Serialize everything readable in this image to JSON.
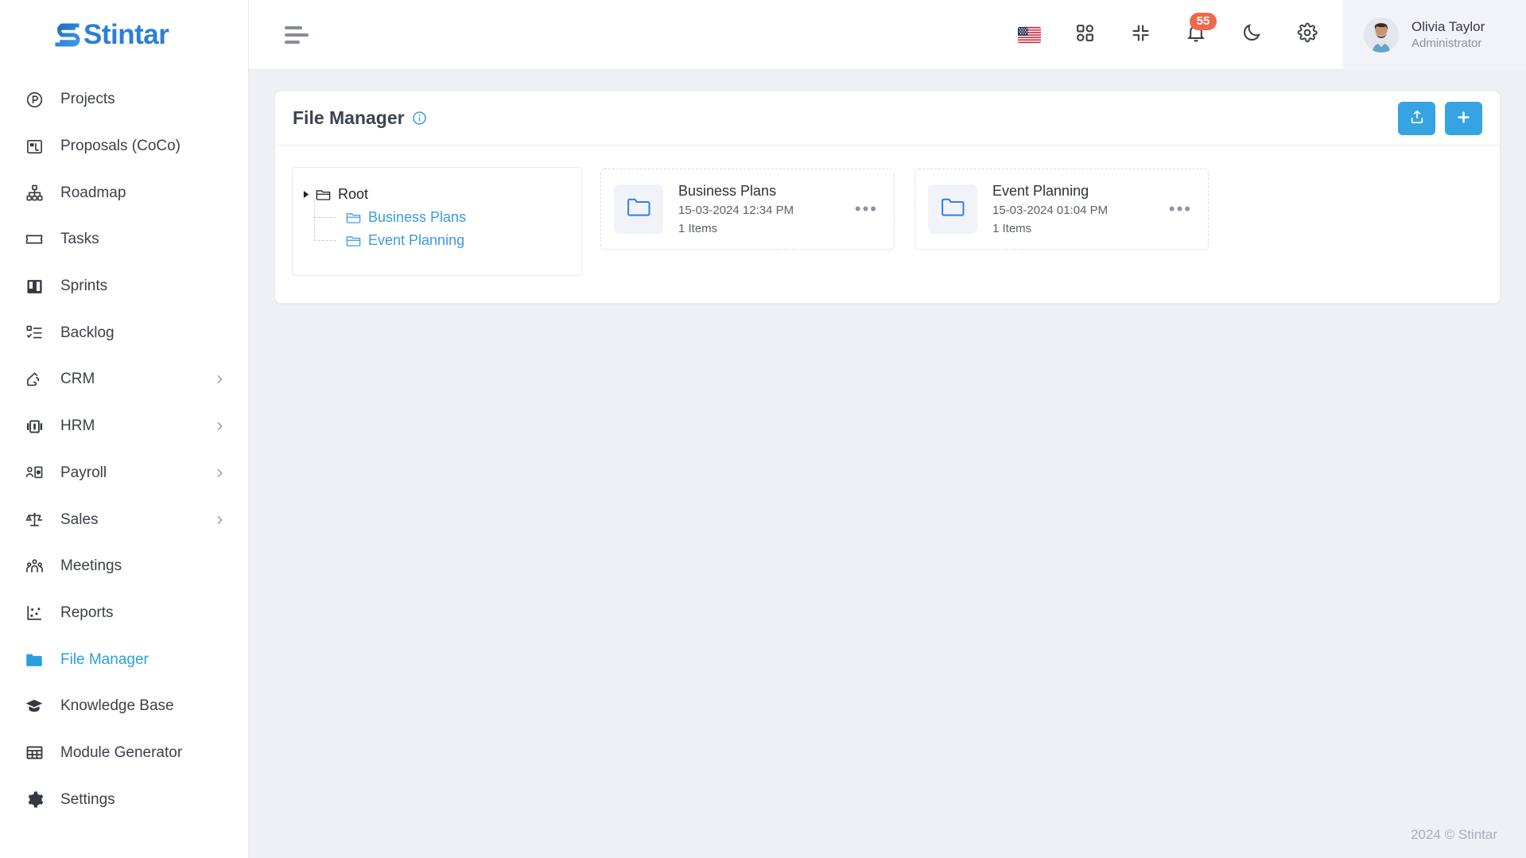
{
  "brand": {
    "name": "Stintar"
  },
  "sidebar": {
    "items": [
      {
        "label": "Projects",
        "icon": "circle-p-icon",
        "chevron": false,
        "active": false
      },
      {
        "label": "Proposals (CoCo)",
        "icon": "proposal-icon",
        "chevron": false,
        "active": false
      },
      {
        "label": "Roadmap",
        "icon": "hierarchy-icon",
        "chevron": false,
        "active": false
      },
      {
        "label": "Tasks",
        "icon": "ticket-icon",
        "chevron": false,
        "active": false
      },
      {
        "label": "Sprints",
        "icon": "board-icon",
        "chevron": false,
        "active": false
      },
      {
        "label": "Backlog",
        "icon": "checklist-icon",
        "chevron": false,
        "active": false
      },
      {
        "label": "CRM",
        "icon": "handshake-icon",
        "chevron": true,
        "active": false
      },
      {
        "label": "HRM",
        "icon": "carousel-icon",
        "chevron": true,
        "active": false
      },
      {
        "label": "Payroll",
        "icon": "person-money-icon",
        "chevron": true,
        "active": false
      },
      {
        "label": "Sales",
        "icon": "scales-icon",
        "chevron": true,
        "active": false
      },
      {
        "label": "Meetings",
        "icon": "people-group-icon",
        "chevron": false,
        "active": false
      },
      {
        "label": "Reports",
        "icon": "scatter-chart-icon",
        "chevron": false,
        "active": false
      },
      {
        "label": "File Manager",
        "icon": "folder-filled-icon",
        "chevron": false,
        "active": true
      },
      {
        "label": "Knowledge Base",
        "icon": "graduation-cap-icon",
        "chevron": false,
        "active": false
      },
      {
        "label": "Module Generator",
        "icon": "grid-table-icon",
        "chevron": false,
        "active": false
      },
      {
        "label": "Settings",
        "icon": "gear-icon",
        "chevron": false,
        "active": false
      }
    ]
  },
  "topbar": {
    "menu_toggle": "hamburger-icon",
    "language_flag": "us-flag-icon",
    "apps_icon": "apps-grid-icon",
    "fullscreen_icon": "compress-icon",
    "notifications_icon": "bell-icon",
    "notifications_count": "55",
    "theme_icon": "moon-icon",
    "settings_icon": "gear-icon",
    "user": {
      "name": "Olivia Taylor",
      "role": "Administrator"
    }
  },
  "page": {
    "title": "File Manager",
    "info_icon": "info-circle-icon",
    "upload_button": "upload-icon",
    "add_button": "plus-icon"
  },
  "tree": {
    "root": {
      "label": "Root",
      "caret": "caret-right-icon",
      "icon": "folder-open-icon"
    },
    "children": [
      {
        "label": "Business Plans",
        "icon": "folder-open-icon"
      },
      {
        "label": "Event Planning",
        "icon": "folder-open-icon"
      }
    ]
  },
  "folders": [
    {
      "name": "Business Plans",
      "date": "15-03-2024 12:34 PM",
      "items": "1 Items",
      "icon": "folder-icon",
      "menu": "more-options-icon"
    },
    {
      "name": "Event Planning",
      "date": "15-03-2024 01:04 PM",
      "items": "1 Items",
      "icon": "folder-icon",
      "menu": "more-options-icon"
    }
  ],
  "footer": {
    "copyright": "2024 © Stintar"
  },
  "colors": {
    "accent": "#36a3e2",
    "brand": "#2b7fd4",
    "badge": "#f0674c",
    "page_bg": "#eef0f5",
    "link": "#3d9ae0"
  }
}
